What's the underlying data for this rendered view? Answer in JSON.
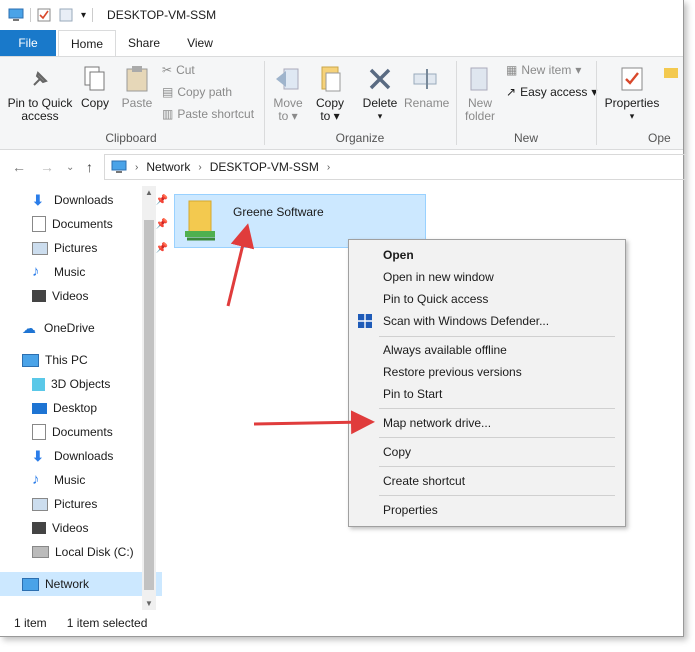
{
  "window": {
    "title": "DESKTOP-VM-SSM"
  },
  "ribbon_tabs": [
    "File",
    "Home",
    "Share",
    "View"
  ],
  "ribbon": {
    "clipboard": {
      "pin": "Pin to Quick\naccess",
      "pin1": "Pin to Quick",
      "pin2": "access",
      "copy": "Copy",
      "paste": "Paste",
      "cut": "Cut",
      "copy_path": "Copy path",
      "paste_shortcut": "Paste shortcut",
      "label": "Clipboard"
    },
    "organize": {
      "move_to1": "Move",
      "move_to2": "to",
      "copy_to1": "Copy",
      "copy_to2": "to",
      "delete": "Delete",
      "rename": "Rename",
      "label": "Organize"
    },
    "new": {
      "new_folder1": "New",
      "new_folder2": "folder",
      "new_item": "New item",
      "easy_access": "Easy access",
      "label": "New"
    },
    "open": {
      "properties": "Properties",
      "label": "Ope"
    }
  },
  "address": {
    "crumbs": [
      "Network",
      "DESKTOP-VM-SSM"
    ]
  },
  "nav": {
    "quick": [
      {
        "label": "Downloads",
        "pinned": true
      },
      {
        "label": "Documents",
        "pinned": true
      },
      {
        "label": "Pictures",
        "pinned": true
      },
      {
        "label": "Music",
        "pinned": false
      },
      {
        "label": "Videos",
        "pinned": false
      }
    ],
    "onedrive": "OneDrive",
    "thispc": "This PC",
    "pc_items": [
      "3D Objects",
      "Desktop",
      "Documents",
      "Downloads",
      "Music",
      "Pictures",
      "Videos",
      "Local Disk (C:)"
    ],
    "network": "Network"
  },
  "content": {
    "folder_name": "Greene Software"
  },
  "status": {
    "count": "1 item",
    "selected": "1 item selected"
  },
  "context_menu": {
    "open": "Open",
    "open_new_window": "Open in new window",
    "pin_quick": "Pin to Quick access",
    "scan": "Scan with Windows Defender...",
    "always_offline": "Always available offline",
    "restore": "Restore previous versions",
    "pin_start": "Pin to Start",
    "map_drive": "Map network drive...",
    "copy": "Copy",
    "create_shortcut": "Create shortcut",
    "properties": "Properties"
  },
  "colors": {
    "accent": "#1979ca",
    "selection": "#cce8ff",
    "arrow": "#e03c3c"
  }
}
